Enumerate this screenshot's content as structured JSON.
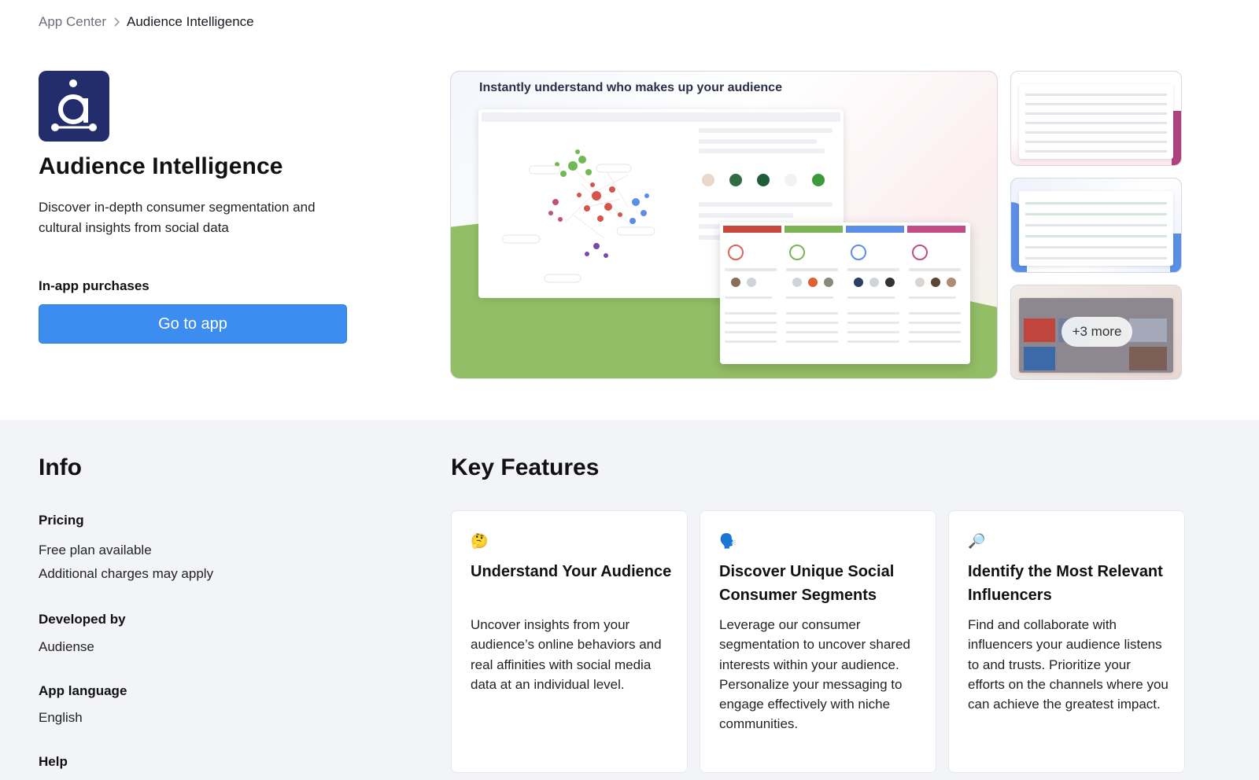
{
  "breadcrumb": {
    "root": "App Center",
    "current": "Audience Intelligence"
  },
  "app": {
    "name": "Audience Intelligence",
    "description": "Discover in-depth consumer segmentation and cultural insights from social data",
    "purchases_label": "In-app purchases",
    "primary_action": "Go to app",
    "brand_color": "#232d6b",
    "accent_color": "#3d8cf0"
  },
  "gallery": {
    "hero_caption": "Instantly understand who makes up your audience",
    "more_label": "+3 more"
  },
  "info": {
    "heading": "Info",
    "pricing_label": "Pricing",
    "pricing_line1": "Free plan available",
    "pricing_line2": "Additional charges may apply",
    "developer_label": "Developed by",
    "developer_value": "Audiense",
    "language_label": "App language",
    "language_value": "English",
    "help_label": "Help"
  },
  "key_features": {
    "heading": "Key Features",
    "cards": [
      {
        "icon": "thinking-face-icon",
        "emoji": "🤔",
        "title": "Understand Your Audience",
        "text": "Uncover insights from your audience’s online behaviors and real affinities with social media data at an individual level."
      },
      {
        "icon": "speaking-head-icon",
        "emoji": "🗣️",
        "title": "Discover Unique Social Consumer Segments",
        "text": "Leverage our consumer segmentation to uncover shared interests within your audience. Personalize your messaging to engage effectively with niche communities."
      },
      {
        "icon": "magnifying-glass-icon",
        "emoji": "🔎",
        "title": "Identify the Most Relevant Influencers",
        "text": "Find and collaborate with influencers your audience listens to and trusts. Prioritize your efforts on the channels where you can achieve the greatest impact."
      }
    ]
  }
}
